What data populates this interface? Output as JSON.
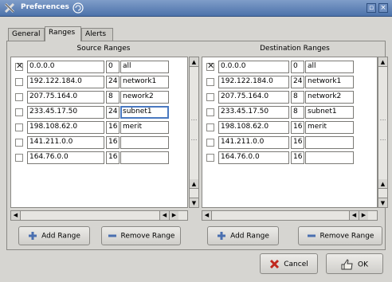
{
  "window": {
    "title": "Preferences"
  },
  "tabs": [
    {
      "label": "General",
      "active": false
    },
    {
      "label": "Ranges",
      "active": true
    },
    {
      "label": "Alerts",
      "active": false
    }
  ],
  "source": {
    "title": "Source Ranges",
    "rows": [
      {
        "checked": true,
        "ip": "0.0.0.0",
        "bits": "0",
        "name": "all"
      },
      {
        "checked": false,
        "ip": "192.122.184.0",
        "bits": "24",
        "name": "network1"
      },
      {
        "checked": false,
        "ip": "207.75.164.0",
        "bits": "8",
        "name": "nework2"
      },
      {
        "checked": false,
        "ip": "233.45.17.50",
        "bits": "24",
        "name": "subnet1"
      },
      {
        "checked": false,
        "ip": "198.108.62.0",
        "bits": "16",
        "name": "merit"
      },
      {
        "checked": false,
        "ip": "141.211.0.0",
        "bits": "16",
        "name": ""
      },
      {
        "checked": false,
        "ip": "164.76.0.0",
        "bits": "16",
        "name": ""
      }
    ],
    "add_label": "Add Range",
    "remove_label": "Remove Range"
  },
  "destination": {
    "title": "Destination Ranges",
    "rows": [
      {
        "checked": true,
        "ip": "0.0.0.0",
        "bits": "0",
        "name": "all"
      },
      {
        "checked": false,
        "ip": "192.122.184.0",
        "bits": "24",
        "name": "network1"
      },
      {
        "checked": false,
        "ip": "207.75.164.0",
        "bits": "8",
        "name": "network2"
      },
      {
        "checked": false,
        "ip": "233.45.17.50",
        "bits": "8",
        "name": "subnet1"
      },
      {
        "checked": false,
        "ip": "198.108.62.0",
        "bits": "16",
        "name": "merit"
      },
      {
        "checked": false,
        "ip": "141.211.0.0",
        "bits": "16",
        "name": ""
      },
      {
        "checked": false,
        "ip": "164.76.0.0",
        "bits": "16",
        "name": ""
      }
    ],
    "add_label": "Add Range",
    "remove_label": "Remove Range"
  },
  "footer": {
    "cancel_label": "Cancel",
    "ok_label": "OK"
  },
  "icons": {
    "app": "x-logo-icon",
    "title_status": "spiral-icon",
    "add": "plus-icon",
    "remove": "minus-icon",
    "cancel": "red-x-icon",
    "ok": "thumbs-up-icon"
  },
  "colors": {
    "titlebar": "#5b7fb5",
    "focus": "#4a79c0",
    "add_icon": "#4a6fb0"
  }
}
